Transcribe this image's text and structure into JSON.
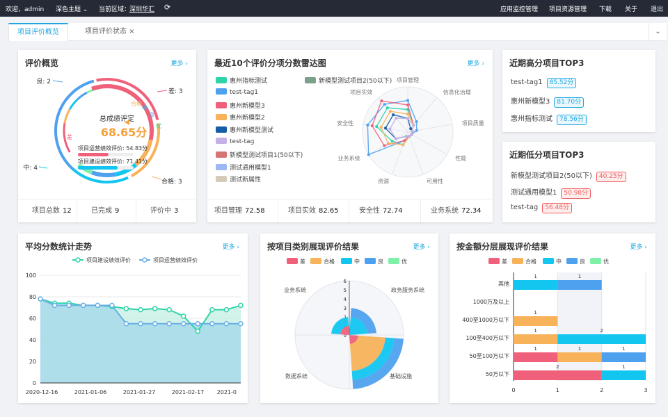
{
  "topbar": {
    "welcome": "欢迎，admin",
    "theme": "深色主题 ⌄",
    "region_label": "当前区域：",
    "region": "深圳华汇",
    "refresh_icon": "refresh-icon",
    "menu": [
      "应用监控管理",
      "项目资源管理",
      "下载",
      "关于",
      "退出"
    ]
  },
  "tabs": [
    {
      "label": "项目评价概览"
    },
    {
      "label": "项目评价状态 ×"
    }
  ],
  "more": "更多 ›",
  "overview": {
    "title": "评价概览",
    "center_title": "总成绩评定",
    "score": "68.65分",
    "ops_label": "项目运营绩效评价: 54.83分",
    "build_label": "项目建设绩效评价: 71.41分",
    "ops_fraction": 0.5483,
    "build_fraction": 0.7141,
    "ring_labels": [
      {
        "text": "良: 2"
      },
      {
        "text": "差: 3"
      },
      {
        "text": "中: 4"
      },
      {
        "text": "合格: 3"
      }
    ],
    "ring_inner": [
      "差",
      "合格",
      "中",
      "良",
      "优"
    ],
    "footer": [
      {
        "label": "项目总数",
        "value": "12"
      },
      {
        "label": "已完成",
        "value": "9"
      },
      {
        "label": "评价中",
        "value": "3"
      }
    ]
  },
  "radar_panel": {
    "title": "最近10个评价分项分数雷达图",
    "legend_left": [
      {
        "name": "惠州指标测试",
        "color": "#2dd4a8"
      },
      {
        "name": "test-tag1",
        "color": "#4ea1ef"
      },
      {
        "name": "惠州新模型3",
        "color": "#f0607a"
      },
      {
        "name": "惠州新模型2",
        "color": "#f7b25a"
      },
      {
        "name": "惠州新模型测试",
        "color": "#145ea8"
      },
      {
        "name": "test-tag",
        "color": "#c4b2e6"
      },
      {
        "name": "新模型测试项目1(50以下)",
        "color": "#d67474"
      },
      {
        "name": "测试通用模型1",
        "color": "#9bb8f5"
      },
      {
        "name": "测试新属性",
        "color": "#d6cbb8"
      }
    ],
    "legend_right": {
      "name": "新模型测试项目2(50以下)",
      "color": "#7ca08a"
    },
    "axes": [
      "项目管理",
      "信息化治理",
      "项目质量",
      "性能",
      "可用性",
      "资源",
      "业务系统",
      "安全性",
      "项目实效"
    ],
    "footer": [
      {
        "label": "项目管理",
        "value": "72.58"
      },
      {
        "label": "项目实效",
        "value": "82.65"
      },
      {
        "label": "安全性",
        "value": "72.74"
      },
      {
        "label": "业务系统",
        "value": "72.34"
      }
    ]
  },
  "top_high": {
    "title": "近期高分项目TOP3",
    "items": [
      {
        "name": "test-tag1",
        "score": "85.52分"
      },
      {
        "name": "惠州新模型3",
        "score": "81.70分"
      },
      {
        "name": "惠州指标测试",
        "score": "78.56分"
      }
    ]
  },
  "top_low": {
    "title": "近期低分项目TOP3",
    "items": [
      {
        "name": "新模型测试项目2(50以下)",
        "score": "40.25分"
      },
      {
        "name": "测试通用模型1",
        "score": "50.98分"
      },
      {
        "name": "test-tag",
        "score": "56.48分"
      }
    ]
  },
  "trend": {
    "title": "平均分数统计走势",
    "legend": [
      {
        "name": "项目建设绩效评价",
        "color": "#2dd4a8"
      },
      {
        "name": "项目运营绩效评价",
        "color": "#6aaee8"
      }
    ]
  },
  "category": {
    "title": "按项目类别展现评价结果",
    "legend": [
      {
        "name": "差",
        "color": "#f0607a"
      },
      {
        "name": "合格",
        "color": "#f7b25a"
      },
      {
        "name": "中",
        "color": "#12c6f0"
      },
      {
        "name": "良",
        "color": "#4ea1ef"
      },
      {
        "name": "优",
        "color": "#7ef0a8"
      }
    ],
    "axis_labels": [
      "业务系统",
      "政务服务系统",
      "数据系统",
      "基础设施"
    ]
  },
  "amount": {
    "title": "按金额分层展现评价结果",
    "legend": [
      {
        "name": "差",
        "color": "#f0607a"
      },
      {
        "name": "合格",
        "color": "#f7b25a"
      },
      {
        "name": "中",
        "color": "#12c6f0"
      },
      {
        "name": "良",
        "color": "#4ea1ef"
      },
      {
        "name": "优",
        "color": "#7ef0a8"
      }
    ]
  },
  "chart_data": [
    {
      "type": "line",
      "ylim": [
        0,
        100
      ],
      "yticks": [
        "0",
        "20",
        "40",
        "60",
        "80",
        "100"
      ],
      "xticks": [
        "2020-12-16",
        "2021-01-06",
        "2021-01-27",
        "2021-02-17",
        "2021-0"
      ],
      "series": [
        {
          "name": "项目建设绩效评价",
          "values": [
            78,
            74,
            74,
            72,
            72,
            71,
            69,
            68,
            69,
            68,
            62,
            48,
            68,
            68,
            72
          ]
        },
        {
          "name": "项目运营绩效评价",
          "values": [
            78,
            72,
            72,
            72,
            72,
            72,
            55,
            55,
            55,
            55,
            55,
            55,
            55,
            55,
            55
          ]
        }
      ]
    },
    {
      "type": "bar",
      "orientation": "horizontal",
      "categories": [
        "其他",
        "1000万及以上",
        "400至1000万以下",
        "100至400万以下",
        "50至100万以下",
        "50万以下"
      ],
      "xlim": [
        0,
        3
      ],
      "xticks": [
        "0",
        "1",
        "2",
        "3"
      ],
      "series": [
        {
          "name": "差",
          "values": [
            0,
            0,
            0,
            0,
            1,
            2
          ]
        },
        {
          "name": "合格",
          "values": [
            0,
            0,
            1,
            1,
            1,
            0
          ]
        },
        {
          "name": "中",
          "values": [
            1,
            0,
            0,
            2,
            0,
            1
          ]
        },
        {
          "name": "良",
          "values": [
            1,
            0,
            0,
            0,
            1,
            0
          ]
        },
        {
          "name": "优",
          "values": [
            0,
            0,
            0,
            0,
            0,
            0
          ]
        }
      ],
      "data_labels": [
        [
          "1",
          "1"
        ],
        [],
        [
          "1"
        ],
        [
          "1",
          "2"
        ],
        [
          "1",
          "1",
          "1"
        ],
        [
          "2",
          "1"
        ]
      ]
    },
    {
      "type": "bar",
      "orientation": "polar-stacked",
      "rlim": [
        0,
        6
      ],
      "rticks": [
        "0",
        "1",
        "2",
        "3",
        "4",
        "5",
        "6"
      ],
      "categories": [
        "政务服务系统",
        "基础设施",
        "数据系统",
        "业务系统"
      ],
      "series": [
        {
          "name": "差",
          "values": [
            0,
            1,
            0,
            1
          ]
        },
        {
          "name": "合格",
          "values": [
            0,
            3,
            0,
            0
          ]
        },
        {
          "name": "中",
          "values": [
            2,
            1,
            0,
            1
          ]
        },
        {
          "name": "良",
          "values": [
            1,
            1,
            0,
            0
          ]
        },
        {
          "name": "优",
          "values": [
            0,
            0,
            0,
            0
          ]
        }
      ]
    }
  ]
}
